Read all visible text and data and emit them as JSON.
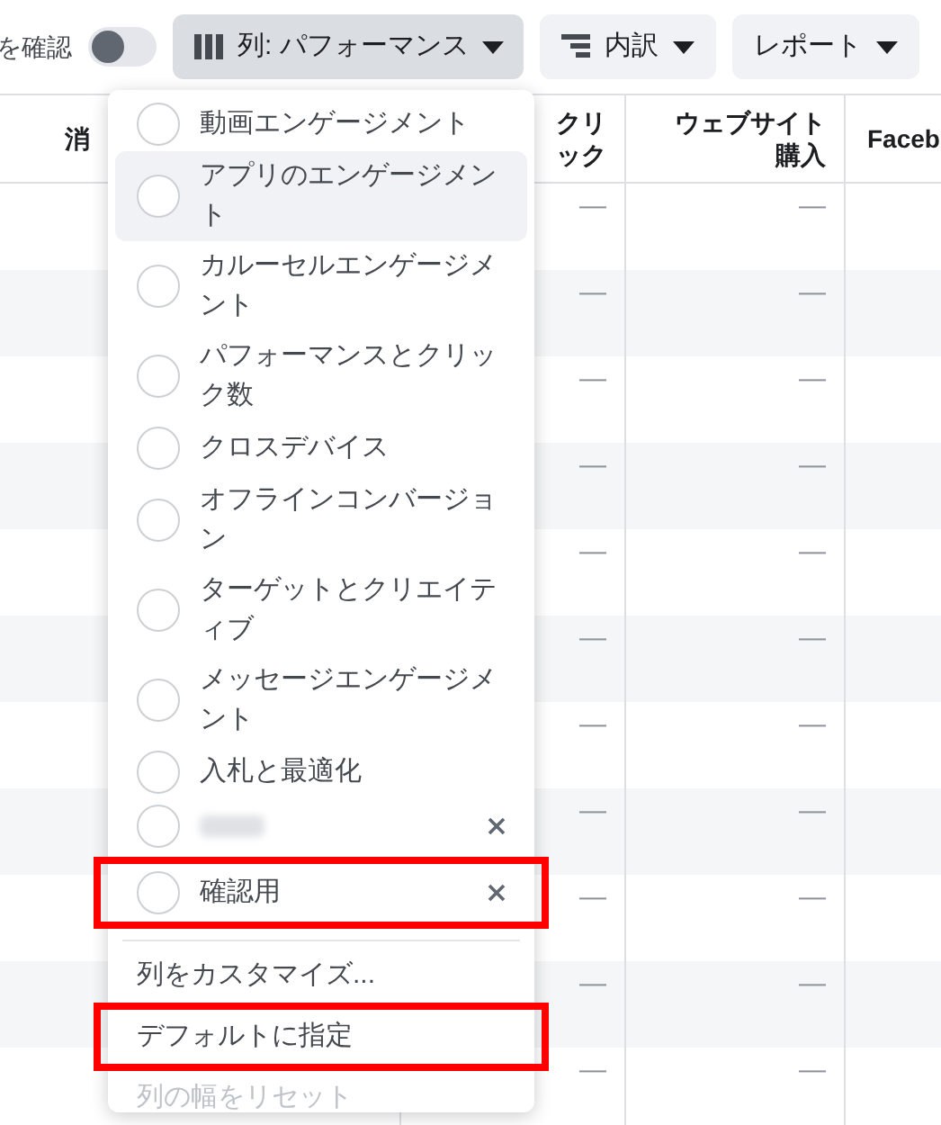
{
  "toolbar": {
    "toggle_label": "を確認",
    "toggle_on": false,
    "buttons": [
      {
        "label": "列: パフォーマンス",
        "kind": "columns",
        "selected": true
      },
      {
        "label": "内訳",
        "kind": "breakdown",
        "selected": false
      },
      {
        "label": "レポート",
        "kind": "plain",
        "selected": false
      }
    ]
  },
  "table": {
    "columns": [
      "消",
      "クリック",
      "ウェブサイト購入",
      "Faceb"
    ],
    "rows": [
      {
        "cells": [
          "",
          "—",
          "—"
        ]
      },
      {
        "cells": [
          "",
          "—",
          "—"
        ]
      },
      {
        "cells": [
          "",
          "—",
          "—"
        ]
      },
      {
        "cells": [
          "",
          "—",
          "—"
        ]
      },
      {
        "cells": [
          "",
          "—",
          "—"
        ]
      },
      {
        "cells": [
          "",
          "—",
          "—"
        ]
      },
      {
        "cells": [
          "",
          "—",
          "—"
        ]
      },
      {
        "cells": [
          "",
          "—",
          "—"
        ]
      },
      {
        "cells": [
          "",
          "—",
          "—"
        ]
      },
      {
        "cells": [
          "",
          "—",
          "—"
        ]
      },
      {
        "cells": [
          "",
          "—",
          "—"
        ]
      }
    ]
  },
  "menu": {
    "presets": [
      {
        "label": "動画エンゲージメント",
        "hovered": false,
        "removable": false
      },
      {
        "label": "アプリのエンゲージメント",
        "hovered": true,
        "removable": false
      },
      {
        "label": "カルーセルエンゲージメント",
        "hovered": false,
        "removable": false
      },
      {
        "label": "パフォーマンスとクリック数",
        "hovered": false,
        "removable": false
      },
      {
        "label": "クロスデバイス",
        "hovered": false,
        "removable": false
      },
      {
        "label": "オフラインコンバージョン",
        "hovered": false,
        "removable": false
      },
      {
        "label": "ターゲットとクリエイティブ",
        "hovered": false,
        "removable": false
      },
      {
        "label": "メッセージエンゲージメント",
        "hovered": false,
        "removable": false
      },
      {
        "label": "入札と最適化",
        "hovered": false,
        "removable": false
      },
      {
        "kind": "blurred",
        "hovered": false,
        "removable": true
      },
      {
        "label": "確認用",
        "hovered": false,
        "removable": true,
        "annotated": true
      }
    ],
    "actions": [
      {
        "label": "列をカスタマイズ...",
        "disabled": false
      },
      {
        "label": "デフォルトに指定",
        "disabled": false,
        "annotated": true
      },
      {
        "label": "列の幅をリセット",
        "disabled": true
      }
    ]
  }
}
